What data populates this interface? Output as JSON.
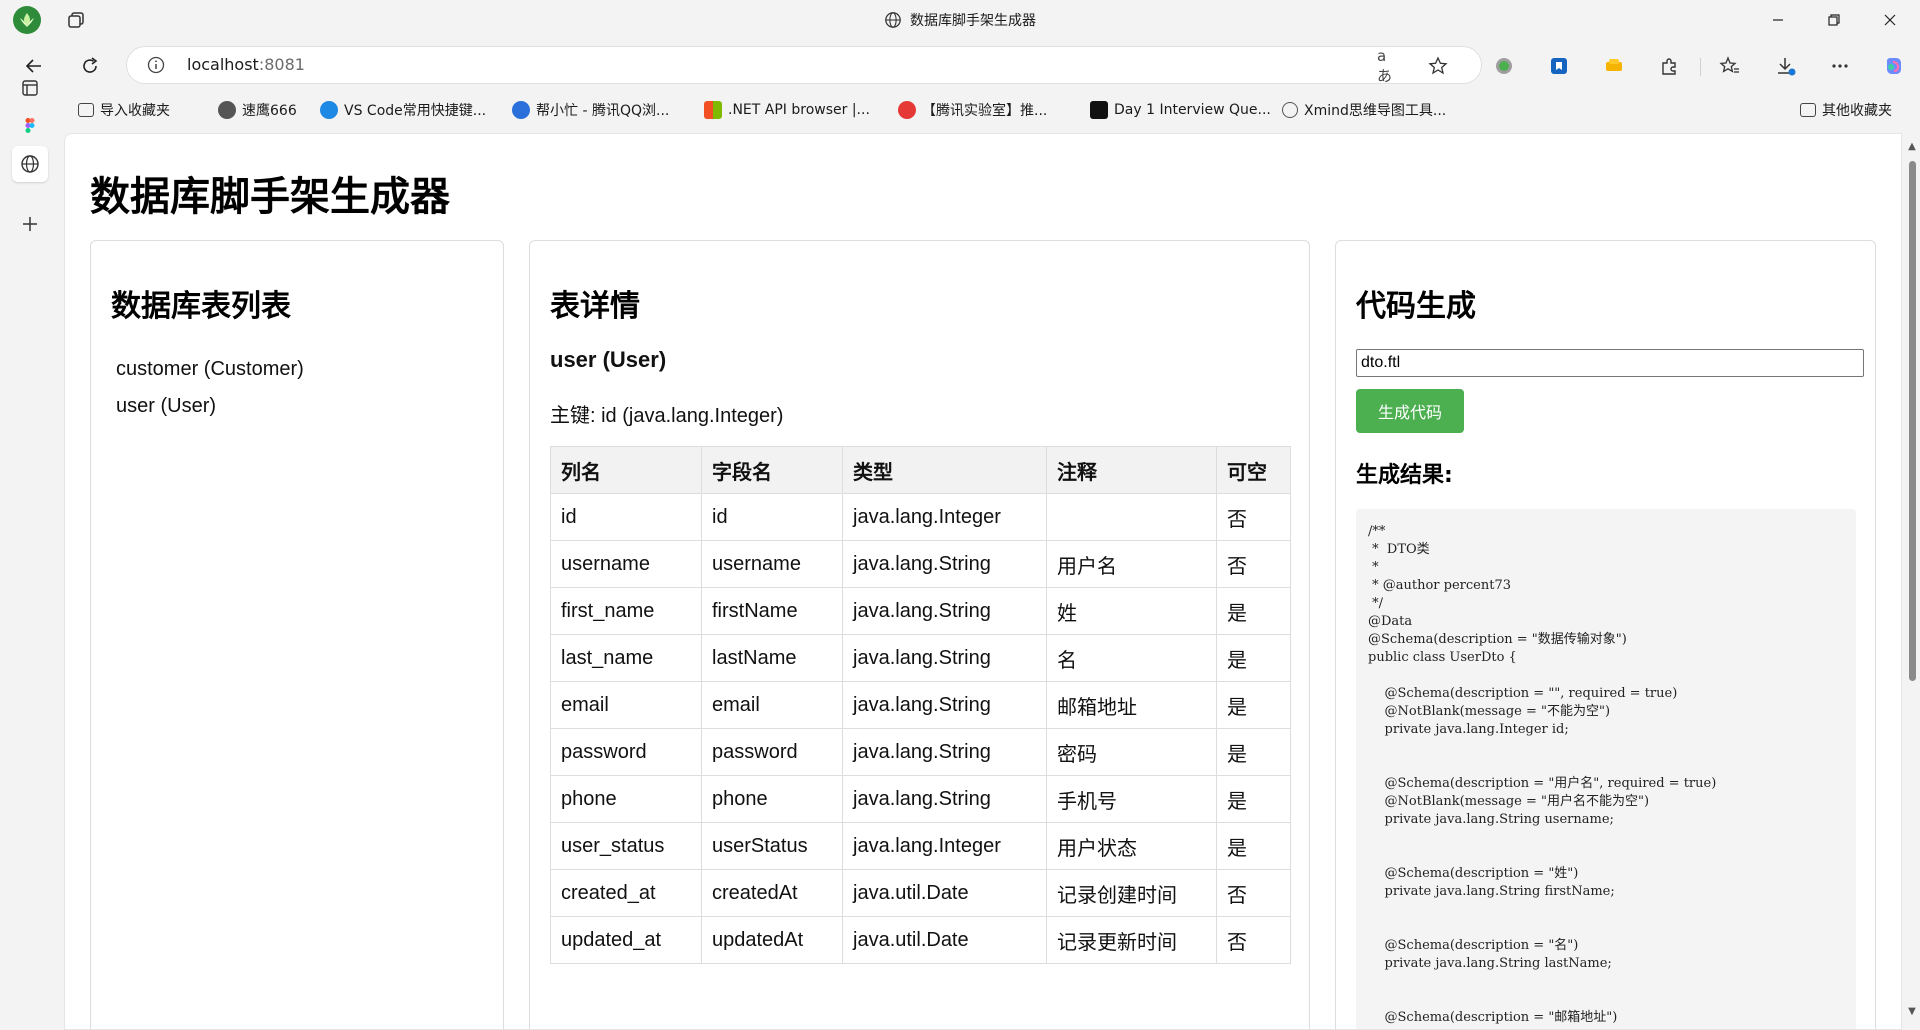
{
  "browser": {
    "window_title": "数据库脚手架生成器",
    "address": {
      "host": "localhost",
      "port": ":8081"
    },
    "translate_glyph": "aあ",
    "favorites": [
      {
        "label": "导入收藏夹",
        "icon": "folder-import-icon",
        "color": "#444444"
      },
      {
        "label": "速鹰666",
        "icon": "avatar-icon",
        "color": "#555555"
      },
      {
        "label": "VS Code常用快捷键...",
        "icon": "vscode-icon",
        "color": "#1e88e5"
      },
      {
        "label": "帮小忙 - 腾讯QQ浏...",
        "icon": "qq-icon",
        "color": "#2b6fdb"
      },
      {
        "label": ".NET API browser |...",
        "icon": "microsoft-icon",
        "color": "#f25022"
      },
      {
        "label": "【腾讯实验室】推...",
        "icon": "lab-icon",
        "color": "#e53935"
      },
      {
        "label": "Day 1 Interview Que...",
        "icon": "hackerrank-icon",
        "color": "#111111"
      },
      {
        "label": "Xmind思维导图工具...",
        "icon": "xmind-icon",
        "color": "#555555"
      }
    ],
    "other_favorites": "其他收藏夹"
  },
  "page": {
    "title": "数据库脚手架生成器",
    "table_list": {
      "heading": "数据库表列表",
      "items": [
        "customer (Customer)",
        "user (User)"
      ]
    },
    "table_detail": {
      "heading": "表详情",
      "subtitle": "user (User)",
      "primary_key": "主键: id (java.lang.Integer)",
      "columns": [
        "列名",
        "字段名",
        "类型",
        "注释",
        "可空"
      ],
      "rows": [
        [
          "id",
          "id",
          "java.lang.Integer",
          "",
          "否"
        ],
        [
          "username",
          "username",
          "java.lang.String",
          "用户名",
          "否"
        ],
        [
          "first_name",
          "firstName",
          "java.lang.String",
          "姓",
          "是"
        ],
        [
          "last_name",
          "lastName",
          "java.lang.String",
          "名",
          "是"
        ],
        [
          "email",
          "email",
          "java.lang.String",
          "邮箱地址",
          "是"
        ],
        [
          "password",
          "password",
          "java.lang.String",
          "密码",
          "是"
        ],
        [
          "phone",
          "phone",
          "java.lang.String",
          "手机号",
          "是"
        ],
        [
          "user_status",
          "userStatus",
          "java.lang.Integer",
          "用户状态",
          "是"
        ],
        [
          "created_at",
          "createdAt",
          "java.util.Date",
          "记录创建时间",
          "否"
        ],
        [
          "updated_at",
          "updatedAt",
          "java.util.Date",
          "记录更新时间",
          "否"
        ]
      ]
    },
    "code_gen": {
      "heading": "代码生成",
      "template_value": "dto.ftl",
      "button_label": "生成代码",
      "button_color": "#4caf50",
      "result_heading": "生成结果:",
      "result_code": "/**\n *  DTO类\n *\n * @author percent73\n */\n@Data\n@Schema(description = \"数据传输对象\")\npublic class UserDto {\n\n    @Schema(description = \"\", required = true)\n    @NotBlank(message = \"不能为空\")\n    private java.lang.Integer id;\n\n\n    @Schema(description = \"用户名\", required = true)\n    @NotBlank(message = \"用户名不能为空\")\n    private java.lang.String username;\n\n\n    @Schema(description = \"姓\")\n    private java.lang.String firstName;\n\n\n    @Schema(description = \"名\")\n    private java.lang.String lastName;\n\n\n    @Schema(description = \"邮箱地址\")"
    }
  }
}
